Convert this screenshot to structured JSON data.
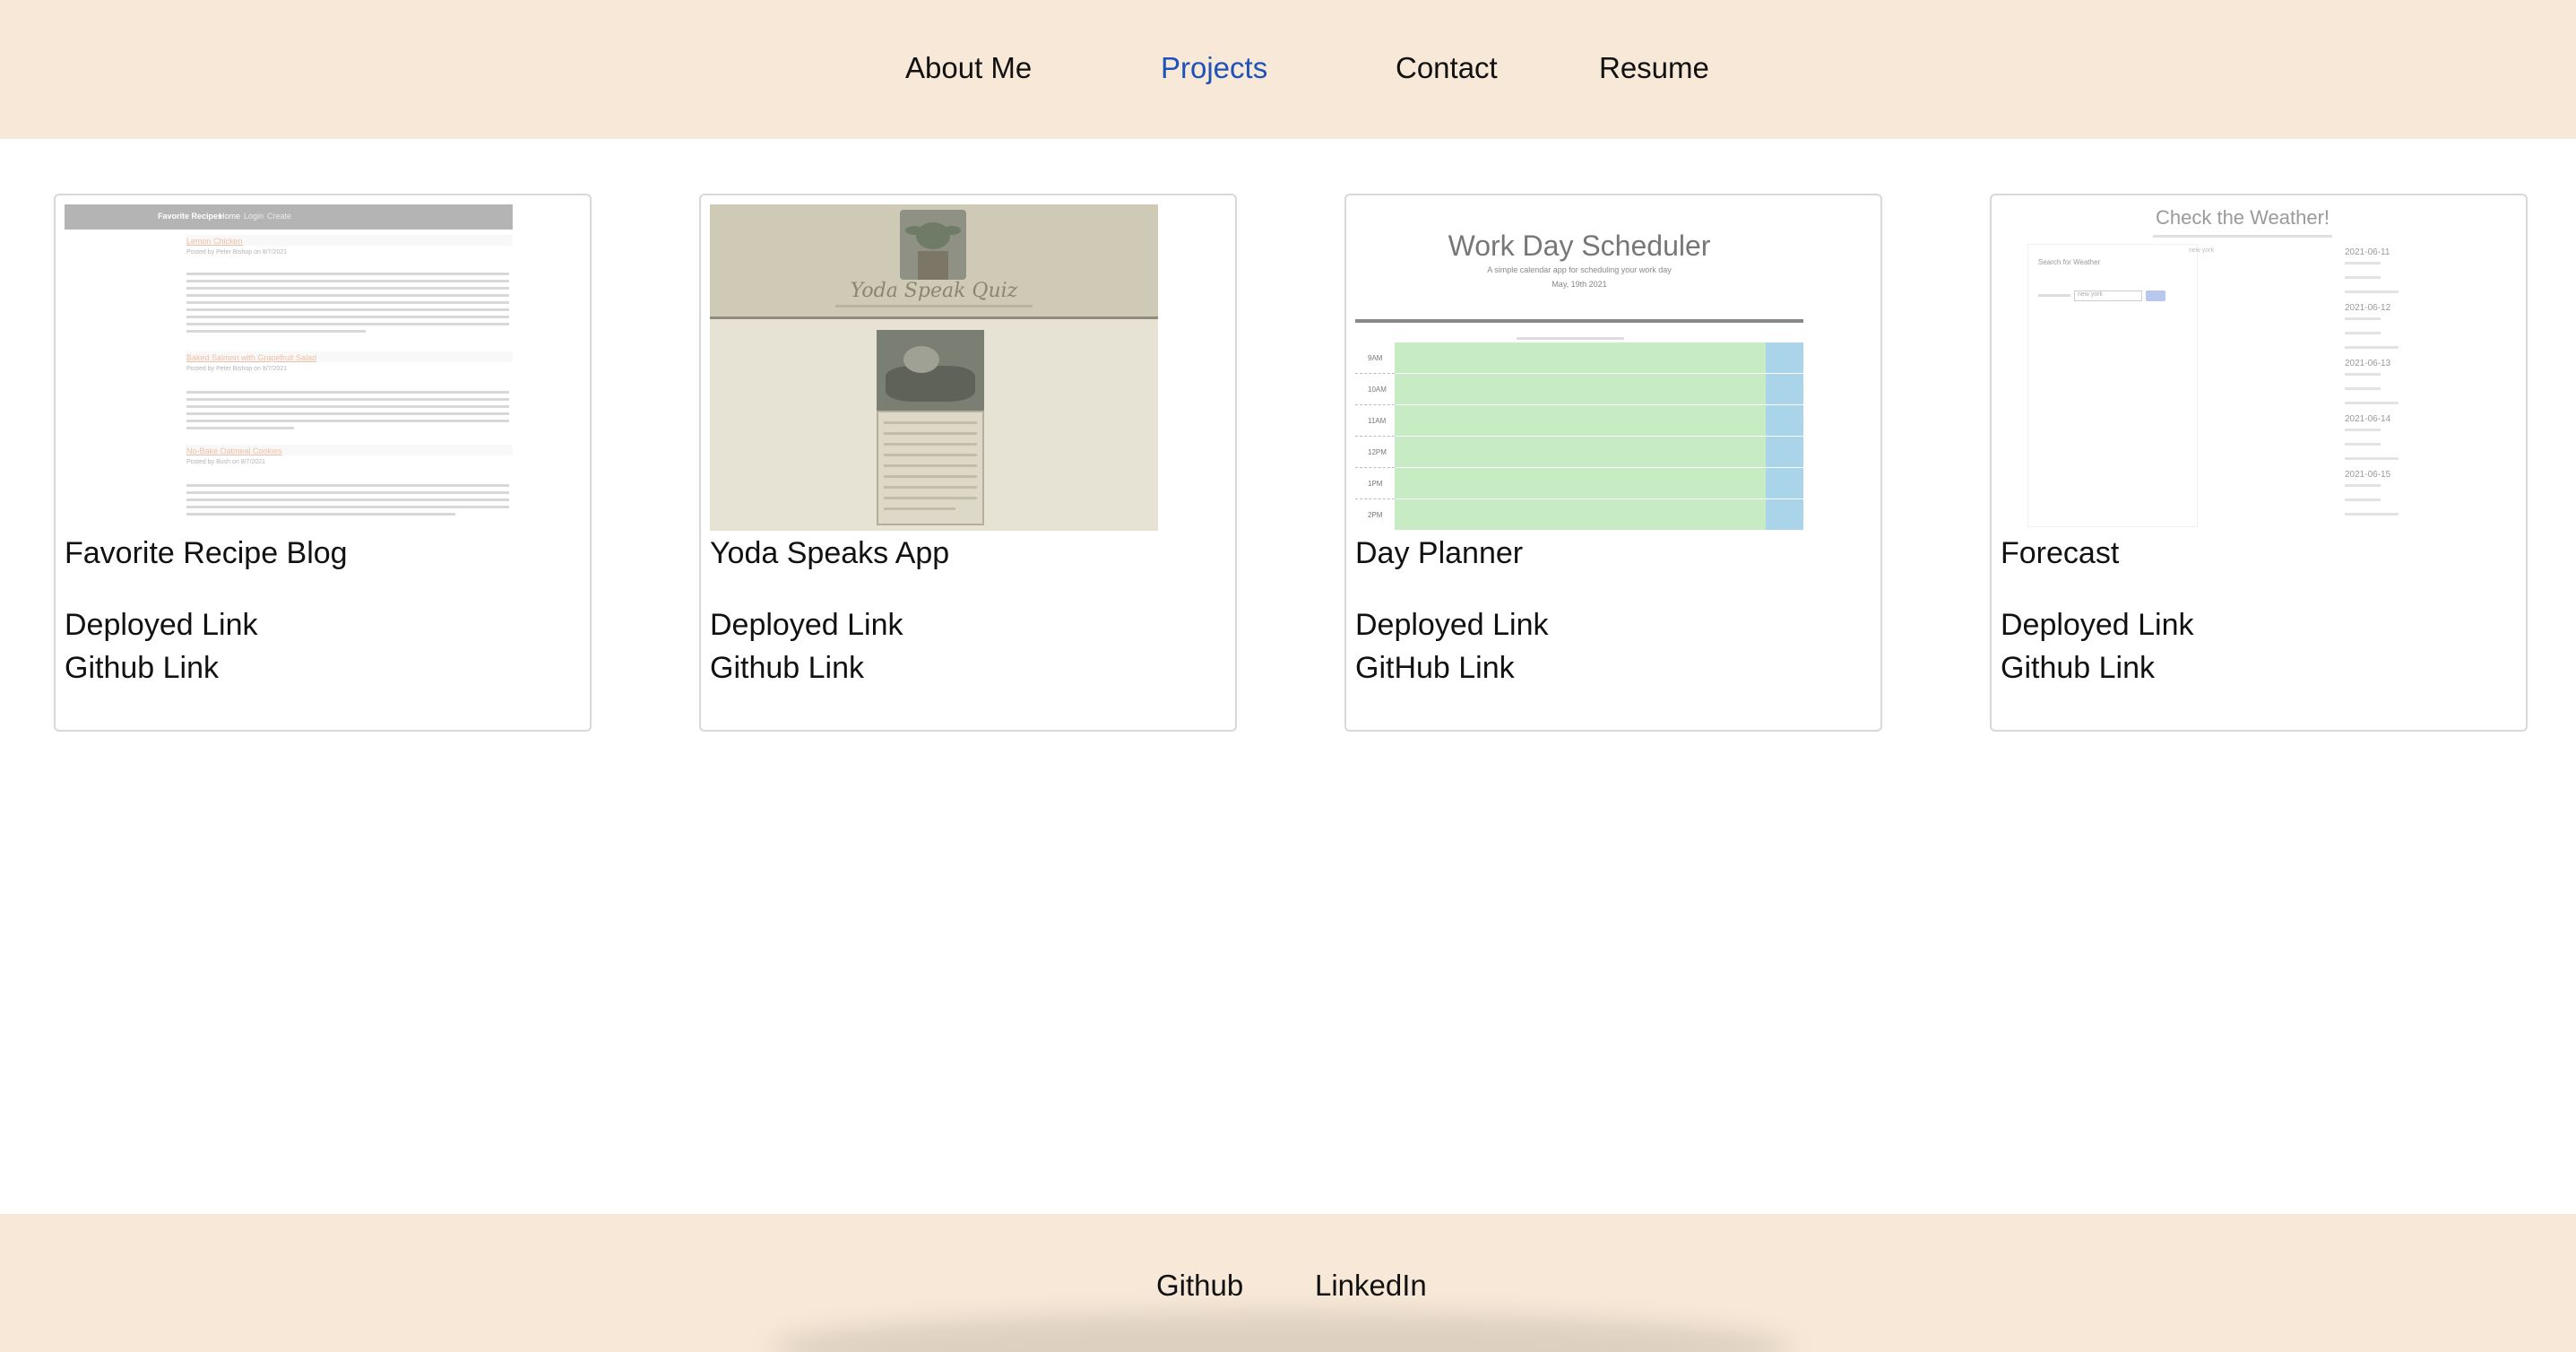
{
  "nav": {
    "items": [
      {
        "label": "About Me",
        "active": false
      },
      {
        "label": "Projects",
        "active": true
      },
      {
        "label": "Contact",
        "active": false
      },
      {
        "label": "Resume",
        "active": false
      }
    ],
    "active_color": "#1d52b8",
    "background": "#f7e8d7"
  },
  "projects": [
    {
      "title": "Favorite Recipe Blog",
      "deployed_label": "Deployed Link",
      "github_label": "Github Link",
      "thumb": {
        "header_brand": "Favorite Recipes",
        "header_links": [
          "Home",
          "Login",
          "Create"
        ],
        "posts": [
          {
            "title": "Lemon Chicken",
            "byline": "Posted by Peter Bishop on 8/7/2021"
          },
          {
            "title": "Baked Salmon with Grapefruit Salad",
            "byline": "Posted by Peter Bishop on 8/7/2021"
          },
          {
            "title": "No-Bake Oatmeal Cookies",
            "byline": "Posted by Bush on 8/7/2021"
          }
        ]
      }
    },
    {
      "title": "Yoda Speaks App",
      "deployed_label": "Deployed Link",
      "github_label": "Github Link",
      "thumb": {
        "heading": "Yoda Speak Quiz"
      }
    },
    {
      "title": "Day Planner",
      "deployed_label": "Deployed Link",
      "github_label": "GitHub Link",
      "thumb": {
        "heading": "Work Day Scheduler",
        "subheading": "A simple calendar app for scheduling your work day",
        "date": "May, 19th 2021",
        "hours": [
          "9AM",
          "10AM",
          "11AM",
          "12PM",
          "1PM",
          "2PM"
        ]
      }
    },
    {
      "title": "Forecast",
      "deployed_label": "Deployed Link",
      "github_label": "Github Link",
      "thumb": {
        "heading": "Check the Weather!",
        "search_label": "Search for Weather",
        "city_value": "new york",
        "dates": [
          "2021-06-11",
          "2021-06-12",
          "2021-06-13",
          "2021-06-14",
          "2021-06-15"
        ]
      }
    }
  ],
  "footer": {
    "links": [
      "Github",
      "LinkedIn"
    ],
    "background": "#f7e8d7"
  }
}
